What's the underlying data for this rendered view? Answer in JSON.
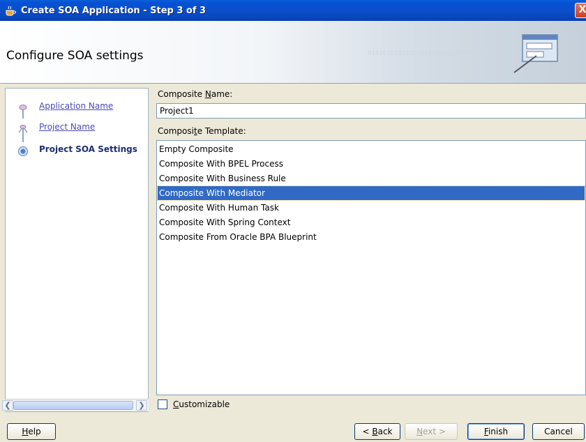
{
  "window": {
    "title": "Create SOA Application - Step 3 of 3",
    "close_glyph": "X"
  },
  "banner": {
    "heading": "Configure SOA settings",
    "binary_text": "0101010101010101010101010101010"
  },
  "nav": {
    "items": [
      {
        "label": "Application Name",
        "state": "link"
      },
      {
        "label": "Project Name",
        "state": "link"
      },
      {
        "label": "Project SOA Settings",
        "state": "current"
      }
    ]
  },
  "form": {
    "composite_name_label_pre": "Composite ",
    "composite_name_label_mnemonic": "N",
    "composite_name_label_post": "ame:",
    "composite_name_value": "Project1",
    "template_label_pre": "Composi",
    "template_label_mnemonic": "t",
    "template_label_post": "e Template:",
    "templates": [
      "Empty Composite",
      "Composite With BPEL Process",
      "Composite With Business Rule",
      "Composite With Mediator",
      "Composite With Human Task",
      "Composite With Spring Context",
      "Composite From Oracle BPA Blueprint"
    ],
    "selected_template_index": 3,
    "customizable_mnemonic": "C",
    "customizable_rest": "ustomizable",
    "customizable_checked": false
  },
  "buttons": {
    "help_mnemonic": "H",
    "help_rest": "elp",
    "back_pre": "< ",
    "back_mnemonic": "B",
    "back_rest": "ack",
    "next_mnemonic": "N",
    "next_rest": "ext >",
    "finish_mnemonic": "F",
    "finish_rest": "inish",
    "cancel": "Cancel"
  },
  "colors": {
    "titlebar": "#0b4fc9",
    "selection": "#316ac5",
    "link": "#4b4bb5",
    "current_step": "#1d2f6e"
  }
}
